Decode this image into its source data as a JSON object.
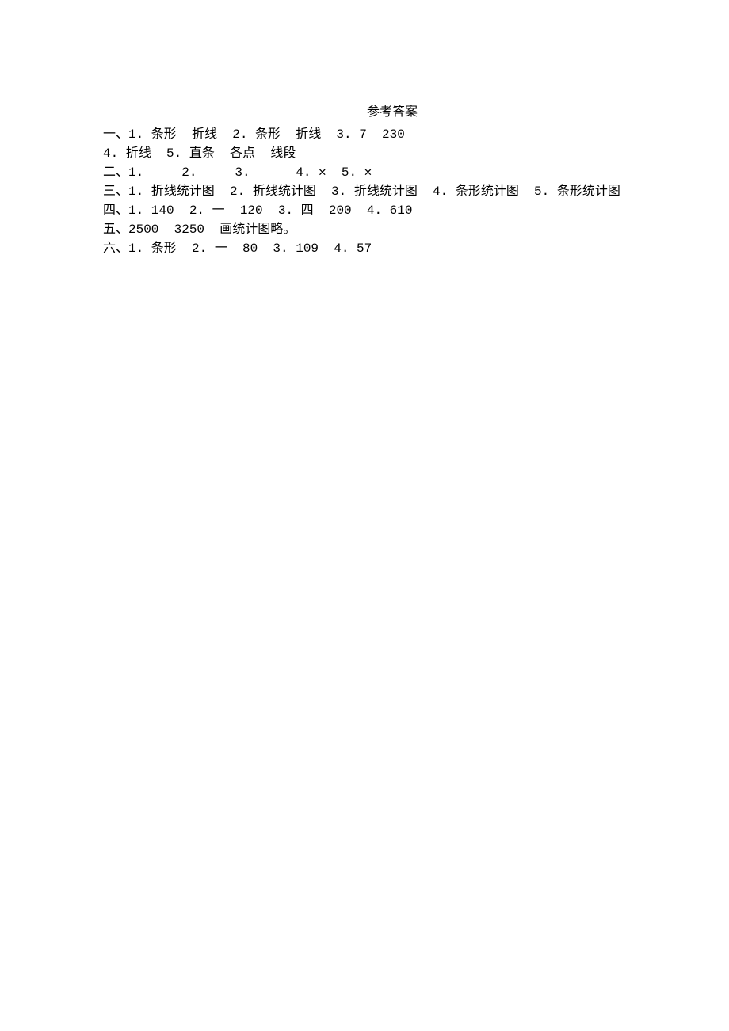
{
  "title": "参考答案",
  "lines": {
    "l1": "一、1. 条形  折线  2. 条形  折线  3. 7  230",
    "l2": "4. 折线  5. 直条  各点  线段",
    "l3": "二、1.     2.     3.      4. ✕  5. ✕",
    "l4": "三、1. 折线统计图  2. 折线统计图  3. 折线统计图  4. 条形统计图  5. 条形统计图",
    "l5": "四、1. 140  2. 一  120  3. 四  200  4. 610",
    "l6": "五、2500  3250  画统计图略。",
    "l7": "六、1. 条形  2. 一  80  3. 109  4. 57"
  }
}
